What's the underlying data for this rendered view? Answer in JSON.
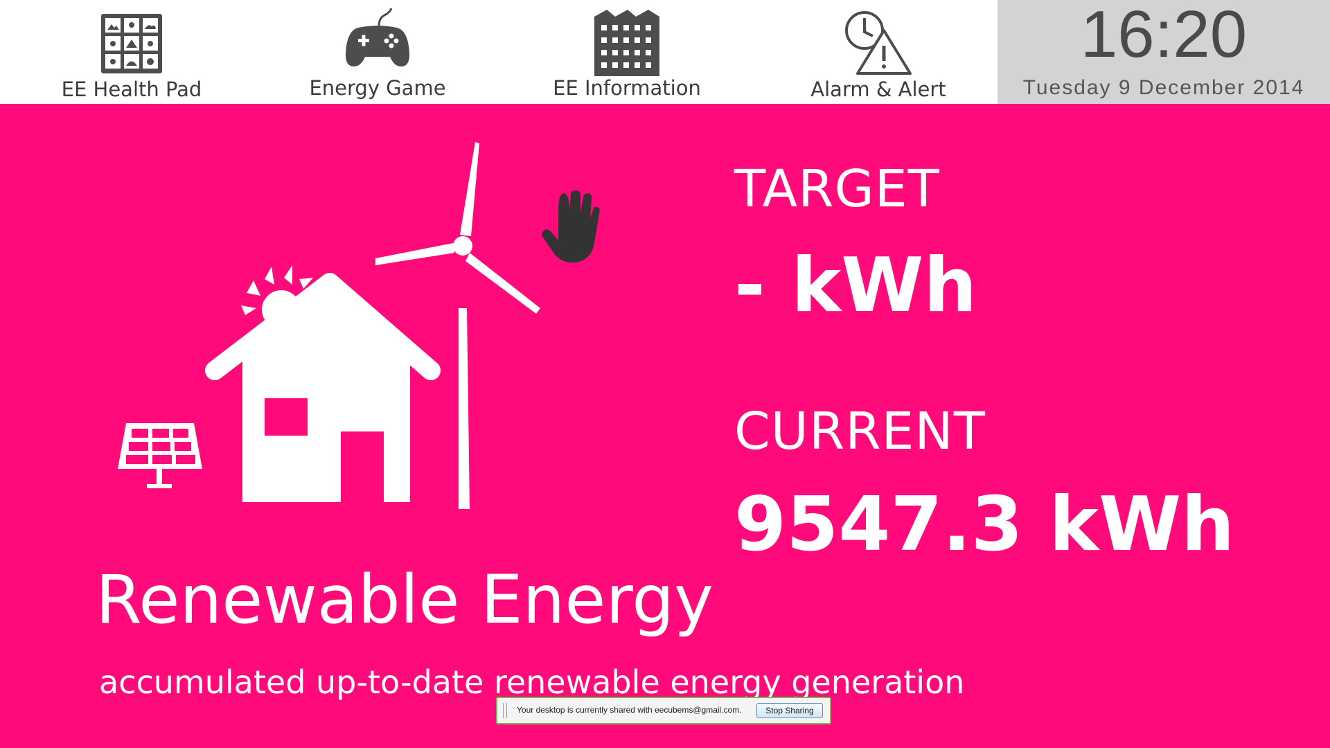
{
  "nav": {
    "items": [
      {
        "label": "EE Health Pad",
        "icon": "health-pad-grid-icon"
      },
      {
        "label": "Energy Game",
        "icon": "gamepad-icon"
      },
      {
        "label": "EE Information",
        "icon": "building-icon"
      },
      {
        "label": "Alarm & Alert",
        "icon": "clock-warning-icon"
      }
    ]
  },
  "clock": {
    "time": "16:20",
    "date": "Tuesday 9 December 2014"
  },
  "main": {
    "background": "#ff0a7a",
    "title": "Renewable Energy",
    "subtitle": "accumulated up-to-date renewable energy generation",
    "target_label": "TARGET",
    "target_value": "- kWh",
    "current_label": "CURRENT",
    "current_value": "9547.3 kWh"
  },
  "share_bar": {
    "message": "Your desktop is currently shared with eecubems@gmail.com.",
    "button_label": "Stop Sharing",
    "border_color": "#6cc04a"
  },
  "colors": {
    "icon_gray": "#4d4d4d",
    "topbar": "#ffffff",
    "clock_panel": "#d3d3d3"
  }
}
